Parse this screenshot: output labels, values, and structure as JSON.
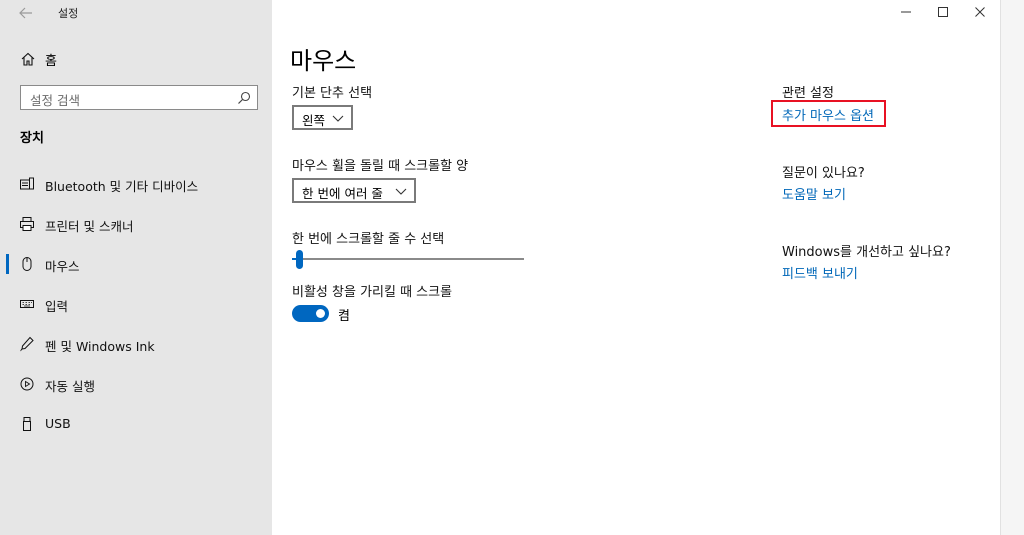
{
  "window": {
    "title": "설정"
  },
  "sidebar": {
    "home_label": "홈",
    "search_placeholder": "설정 검색",
    "section_header": "장치",
    "items": [
      {
        "label": "Bluetooth 및 기타 디바이스",
        "icon": "bluetooth-devices-icon"
      },
      {
        "label": "프린터 및 스캐너",
        "icon": "printer-icon"
      },
      {
        "label": "마우스",
        "icon": "mouse-icon",
        "active": true
      },
      {
        "label": "입력",
        "icon": "keyboard-icon"
      },
      {
        "label": "펜 및 Windows Ink",
        "icon": "pen-icon"
      },
      {
        "label": "자동 실행",
        "icon": "autoplay-icon"
      },
      {
        "label": "USB",
        "icon": "usb-icon"
      }
    ]
  },
  "main": {
    "title": "마우스",
    "primary_button": {
      "label": "기본 단추 선택",
      "value": "왼쪽"
    },
    "scroll_wheel": {
      "label": "마우스 휠을 돌릴 때 스크롤할 양",
      "value": "한 번에 여러 줄"
    },
    "lines_to_scroll": {
      "label": "한 번에 스크롤할 줄 수 선택",
      "value_fraction": 0.02
    },
    "inactive_scroll": {
      "label": "비활성 창을 가리킬 때 스크롤",
      "state": "켬",
      "on": true
    }
  },
  "related": {
    "header": "관련 설정",
    "link": "추가 마우스 옵션",
    "question_header": "질문이 있나요?",
    "help_link": "도움말 보기",
    "improve_header": "Windows를 개선하고 싶나요?",
    "feedback_link": "피드백 보내기"
  },
  "colors": {
    "accent": "#0067c0",
    "link": "#0067b8",
    "highlight": "#e81123",
    "sidebar_bg": "#e6e6e6"
  }
}
